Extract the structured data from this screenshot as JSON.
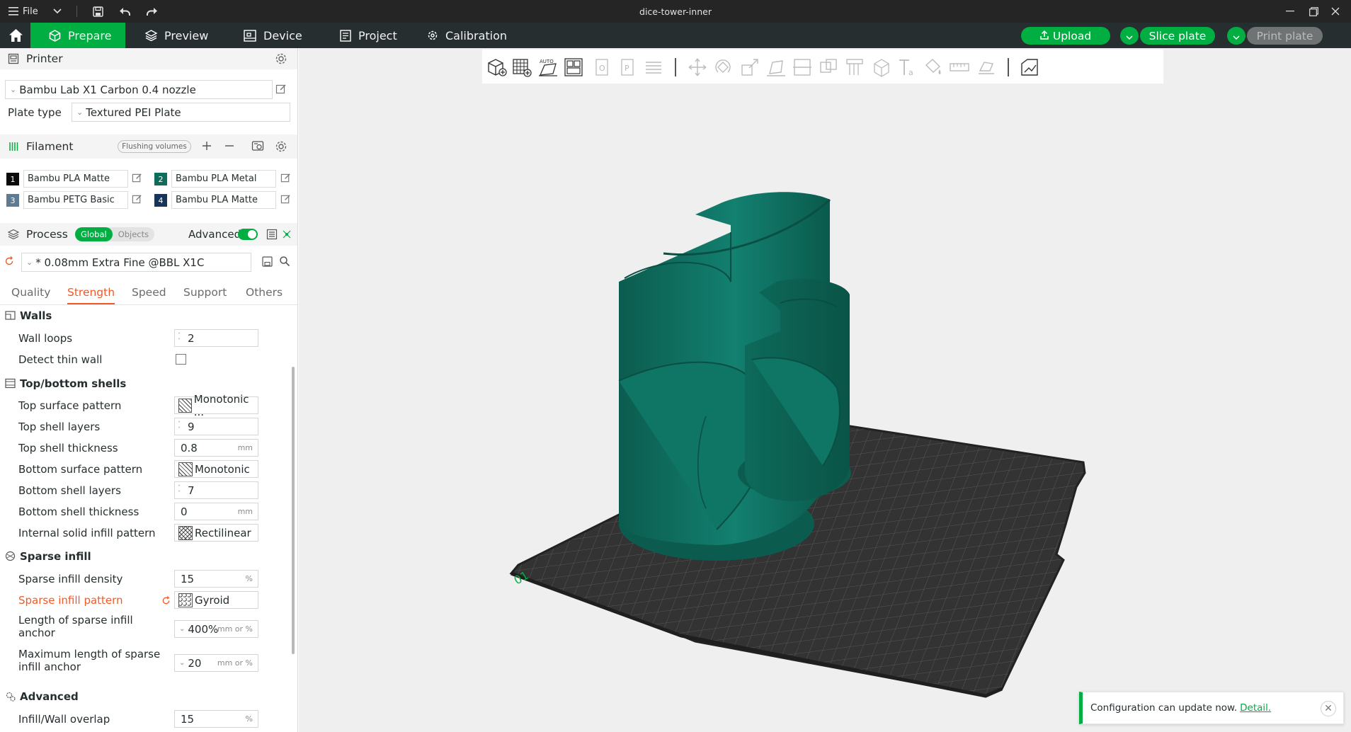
{
  "window": {
    "title": "dice-tower-inner",
    "file_menu": "File"
  },
  "tabs": {
    "prepare": "Prepare",
    "preview": "Preview",
    "device": "Device",
    "project": "Project",
    "calibration": "Calibration"
  },
  "actions": {
    "upload": "Upload",
    "slice_plate": "Slice plate",
    "print_plate": "Print plate"
  },
  "printer": {
    "section": "Printer",
    "preset": "Bambu Lab X1 Carbon 0.4 nozzle",
    "plate_type_label": "Plate type",
    "plate_type": "Textured PEI Plate"
  },
  "filament": {
    "section": "Filament",
    "flushing_volumes": "Flushing volumes",
    "items": [
      {
        "num": "1",
        "name": "Bambu PLA Matte",
        "color": "#0b0b0b"
      },
      {
        "num": "2",
        "name": "Bambu PLA Metal",
        "color": "#0f6b5a"
      },
      {
        "num": "3",
        "name": "Bambu PETG Basic",
        "color": "#5f7b91"
      },
      {
        "num": "4",
        "name": "Bambu PLA Matte",
        "color": "#17355a"
      }
    ]
  },
  "process": {
    "section": "Process",
    "seg_global": "Global",
    "seg_objects": "Objects",
    "advanced_label": "Advanced",
    "preset": "* 0.08mm Extra Fine @BBL X1C",
    "subtabs": {
      "quality": "Quality",
      "strength": "Strength",
      "speed": "Speed",
      "support": "Support",
      "others": "Others"
    }
  },
  "strength": {
    "walls": {
      "title": "Walls",
      "wall_loops": {
        "label": "Wall loops",
        "value": "2"
      },
      "detect_thin_wall": {
        "label": "Detect thin wall",
        "checked": false
      }
    },
    "shells": {
      "title": "Top/bottom shells",
      "top_surface_pattern": {
        "label": "Top surface pattern",
        "value": "Monotonic ..."
      },
      "top_shell_layers": {
        "label": "Top shell layers",
        "value": "9"
      },
      "top_shell_thickness": {
        "label": "Top shell thickness",
        "value": "0.8",
        "unit": "mm"
      },
      "bottom_surface_pattern": {
        "label": "Bottom surface pattern",
        "value": "Monotonic"
      },
      "bottom_shell_layers": {
        "label": "Bottom shell layers",
        "value": "7"
      },
      "bottom_shell_thickness": {
        "label": "Bottom shell thickness",
        "value": "0",
        "unit": "mm"
      },
      "internal_solid_infill_pattern": {
        "label": "Internal solid infill pattern",
        "value": "Rectilinear"
      }
    },
    "sparse": {
      "title": "Sparse infill",
      "density": {
        "label": "Sparse infill density",
        "value": "15",
        "unit": "%"
      },
      "pattern": {
        "label": "Sparse infill pattern",
        "value": "Gyroid"
      },
      "anchor_len_1": "Length of sparse infill",
      "anchor_len_2": "anchor",
      "anchor_value": "400%",
      "anchor_unit": "mm or %",
      "max_anchor_1": "Maximum length of sparse",
      "max_anchor_2": "infill anchor",
      "max_anchor_value": "20",
      "max_anchor_unit": "mm or %"
    },
    "advanced": {
      "title": "Advanced",
      "overlap": {
        "label": "Infill/Wall overlap",
        "value": "15",
        "unit": "%"
      }
    }
  },
  "viewport": {
    "plate_label": "01",
    "model_color": "#0d6b5b",
    "bed_color": "#333333"
  },
  "notification": {
    "text": "Configuration can update now.",
    "link": "Detail."
  },
  "colors": {
    "accent": "#00ae42",
    "modified": "#f05a28",
    "topbar": "#262e30"
  }
}
